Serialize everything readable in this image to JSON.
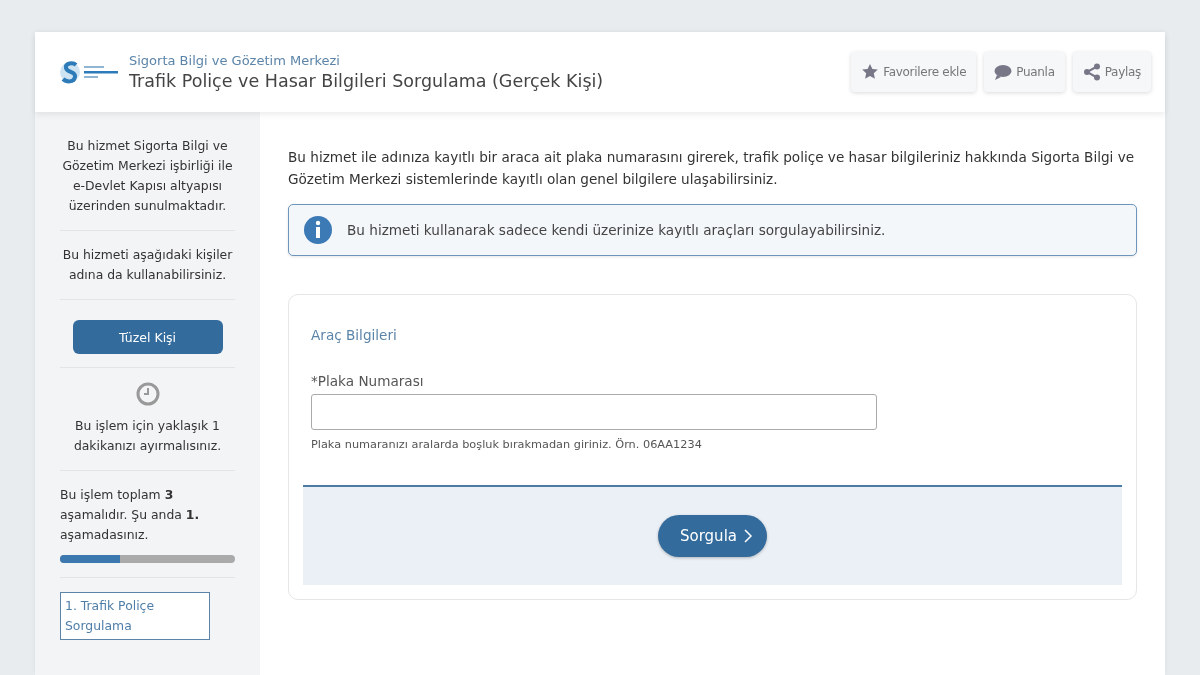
{
  "header": {
    "org": "Sigorta Bilgi ve Gözetim Merkezi",
    "title": "Trafik Poliçe ve Hasar Bilgileri Sorgulama (Gerçek Kişi)",
    "actions": [
      {
        "kind": "star",
        "label": "Favorilere ekle"
      },
      {
        "kind": "chat",
        "label": "Puanla"
      },
      {
        "kind": "share",
        "label": "Paylaş"
      }
    ]
  },
  "sidebar": {
    "about": "Bu hizmet Sigorta Bilgi ve Gözetim Merkezi işbirliği ile e-Devlet Kapısı altyapısı üzerinden sunulmaktadır.",
    "others_note": "Bu hizmeti aşağıdaki kişiler adına da kullanabilirsiniz.",
    "other_button": "Tüzel Kişi",
    "time_note": "Bu işlem için yaklaşık 1 dakikanızı ayırmalısınız.",
    "steps_note": "Bu işlem toplam **3** aşamalıdır. Şu anda **1.** aşamadasınız.",
    "progress": {
      "level": 0.34
    },
    "steps": [
      {
        "label": "1. Trafik Poliçe Sorgulama",
        "selected": true
      }
    ]
  },
  "main": {
    "intro": "Bu hizmet ile adınıza kayıtlı bir araca ait plaka numarasını girerek, trafik poliçe ve hasar bilgileriniz hakkında Sigorta Bilgi ve Gözetim Merkezi sistemlerinde kayıtlı olan genel bilgilere ulaşabilirsiniz.",
    "info": "Bu hizmeti kullanarak sadece kendi üzerinize kayıtlı araçları sorgulayabilirsiniz.",
    "form": {
      "section": "Araç Bilgileri",
      "field_label": "*Plaka Numarası",
      "hint": "Plaka numaranızı aralarda boşluk bırakmadan giriniz. Örn. 06AA1234",
      "submit": "Sorgula"
    }
  }
}
